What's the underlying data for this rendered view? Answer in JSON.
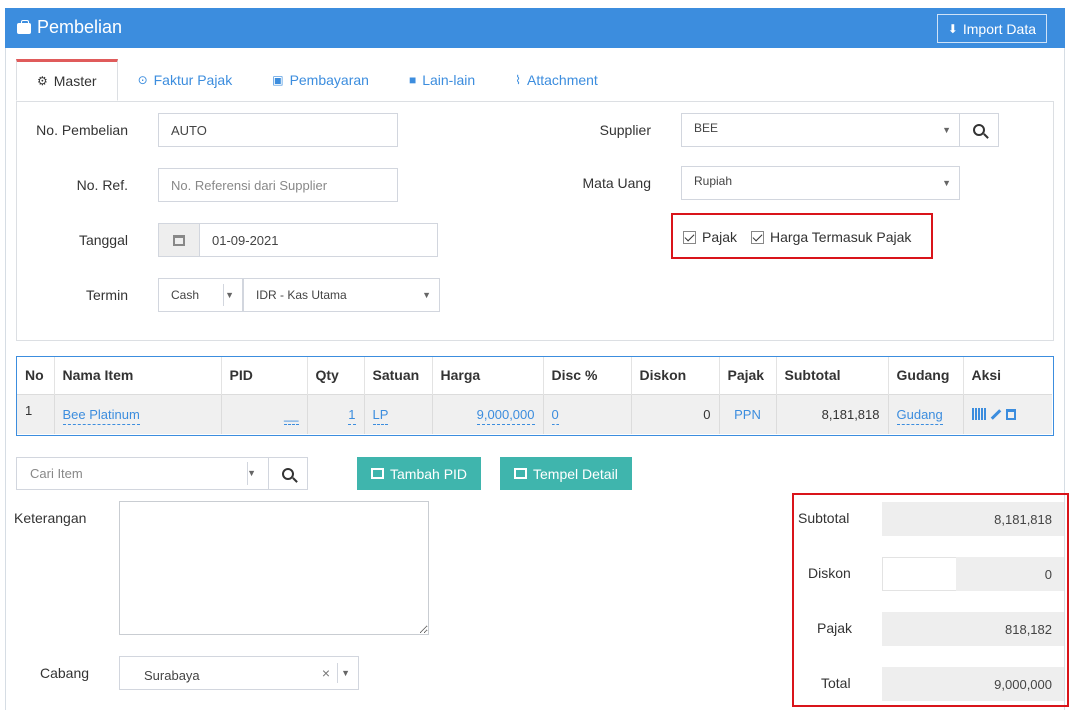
{
  "header": {
    "title": "Pembelian",
    "import_label": "Import Data"
  },
  "tabs": [
    {
      "label": "Master",
      "icon": "cogs-icon"
    },
    {
      "label": "Faktur Pajak",
      "icon": "check-circle-icon"
    },
    {
      "label": "Pembayaran",
      "icon": "money-icon"
    },
    {
      "label": "Lain-lain",
      "icon": "truck-icon"
    },
    {
      "label": "Attachment",
      "icon": "paperclip-icon"
    }
  ],
  "master": {
    "no_pembelian_label": "No. Pembelian",
    "no_pembelian_value": "AUTO",
    "no_ref_label": "No. Ref.",
    "no_ref_placeholder": "No. Referensi dari Supplier",
    "tanggal_label": "Tanggal",
    "tanggal_value": "01-09-2021",
    "termin_label": "Termin",
    "termin_value": "Cash",
    "kas_value": "IDR - Kas Utama",
    "supplier_label": "Supplier",
    "supplier_value": "BEE",
    "mata_uang_label": "Mata Uang",
    "mata_uang_value": "Rupiah",
    "pajak_label": "Pajak",
    "pajak_checked": true,
    "harga_termasuk_pajak_label": "Harga Termasuk Pajak",
    "harga_termasuk_pajak_checked": true
  },
  "table": {
    "headers": [
      "No",
      "Nama Item",
      "PID",
      "Qty",
      "Satuan",
      "Harga",
      "Disc %",
      "Diskon",
      "Pajak",
      "Subtotal",
      "Gudang",
      "Aksi"
    ],
    "rows": [
      {
        "no": "1",
        "nama_item": "Bee Platinum",
        "pid": "__",
        "qty": "1",
        "satuan": "LP",
        "harga": "9,000,000",
        "disc_pct": "0",
        "diskon": "0",
        "pajak": "PPN",
        "subtotal": "8,181,818",
        "gudang": "Gudang"
      }
    ]
  },
  "bottom": {
    "cari_placeholder": "Cari Item",
    "tambah_pid_label": "Tambah PID",
    "tempel_detail_label": "Tempel Detail",
    "keterangan_label": "Keterangan",
    "cabang_label": "Cabang",
    "cabang_value": "Surabaya",
    "clear_symbol": "×"
  },
  "totals": {
    "subtotal_label": "Subtotal",
    "subtotal_value": "8,181,818",
    "diskon_label": "Diskon",
    "diskon_value": "0",
    "pajak_label": "Pajak",
    "pajak_value": "818,182",
    "total_label": "Total",
    "total_value": "9,000,000"
  },
  "colors": {
    "header_bg": "#3c8dde",
    "teal_button": "#3fb5ad",
    "highlight_border": "#d9141a"
  }
}
